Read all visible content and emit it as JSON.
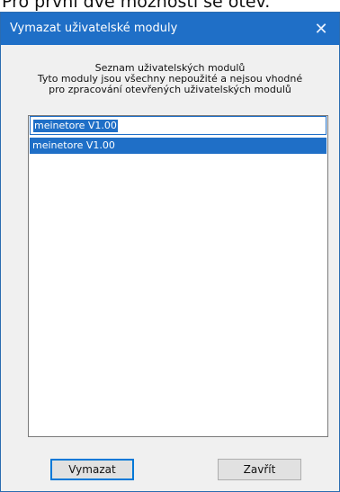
{
  "background": {
    "cropped_text": "Pro první dvě možnosti se otev."
  },
  "dialog": {
    "title": "Vymazat uživatelské moduly",
    "close_glyph": "✕"
  },
  "header": {
    "line1": "Seznam uživatelských modulů",
    "line2": "Tyto moduly jsou všechny nepoužité a nejsou vhodné",
    "line3": "pro zpracování otevřených uživatelských modulů"
  },
  "list": {
    "edit_value": "meinetore V1.00",
    "items": [
      "meinetore V1.00"
    ]
  },
  "buttons": {
    "delete_label": "Vymazat",
    "close_label": "Zavřít"
  },
  "colors": {
    "titlebar": "#1f6fc7",
    "selection": "#1f6fc7",
    "dialog_bg": "#f0f0f0"
  }
}
